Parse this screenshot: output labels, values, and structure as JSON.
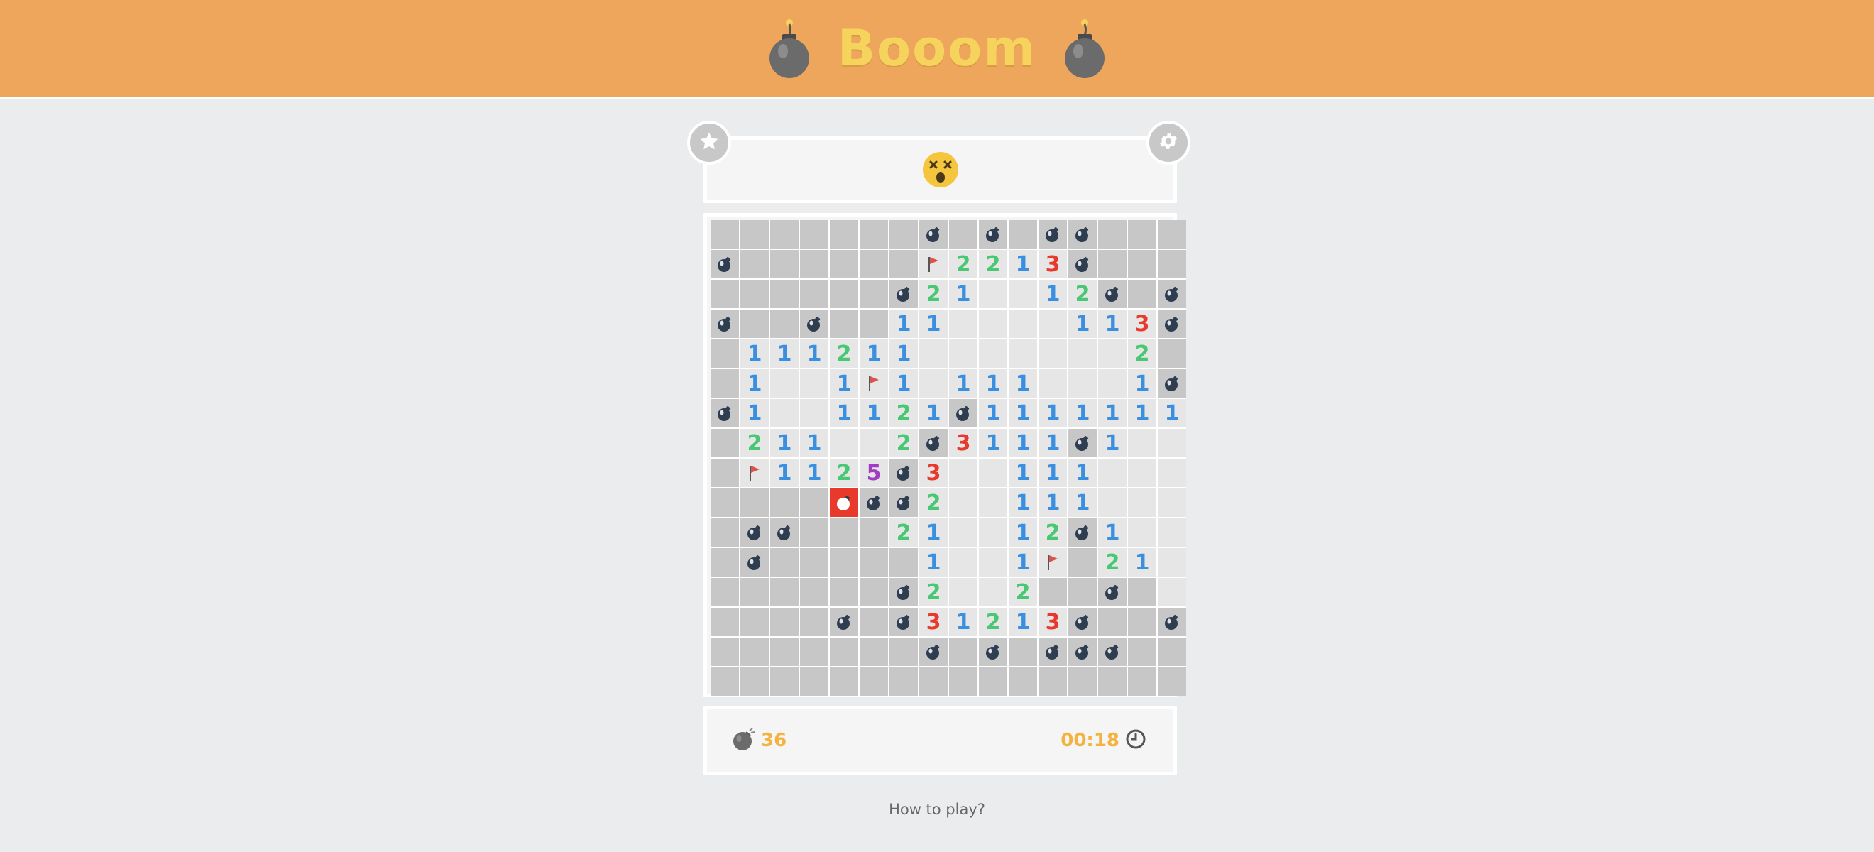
{
  "header": {
    "title": "Booom",
    "left_icon": "bomb-icon",
    "right_icon": "bomb-icon"
  },
  "top_bar": {
    "left_button_icon": "star-icon",
    "right_button_icon": "gear-icon",
    "face_icon": "dizzy-face-icon",
    "game_state": "lost"
  },
  "board": {
    "rows": 16,
    "cols": 16,
    "legend": {
      "#": "hidden",
      ".": "open-empty",
      "B": "mine",
      "F": "flag",
      "X": "exploded-mine",
      "1-8": "number"
    },
    "cells": [
      "#######B#B#BB###",
      "B######F2213B###",
      "######B21..12B#B",
      "B##B##11....113B",
      "#111211.......2#",
      "#1..1F1.111...1B",
      "B1..1121B1111111",
      "#211..2B3111B1..",
      "#F1125B3..111...",
      "####XBB2..111...",
      "#BB###21..12B1..",
      "#B#####1..1F#21.",
      "######B2..2##B#.",
      "####B#B31213B##B",
      "#######B#B#BBB##",
      "################"
    ],
    "colors": {
      "1": "#3b8fe0",
      "2": "#49c873",
      "3": "#e8392d",
      "5": "#a23cc3"
    }
  },
  "status": {
    "mines_icon": "bomb-icon",
    "mines_remaining": "36",
    "time": "00:18",
    "clock_icon": "clock-icon"
  },
  "footer": {
    "how_to_play": "How to play?"
  }
}
